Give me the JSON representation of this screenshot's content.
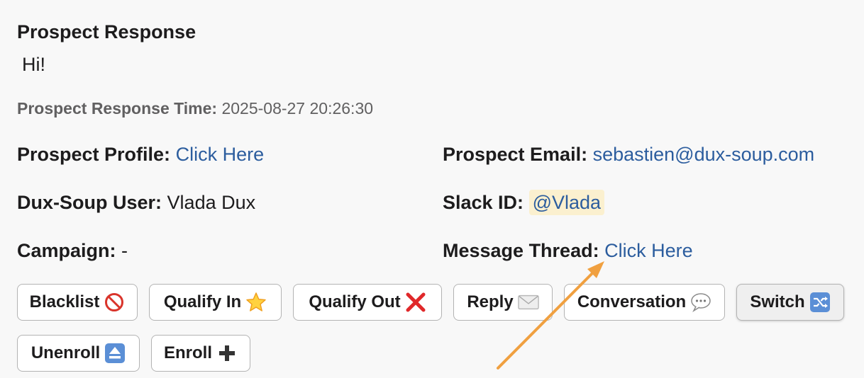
{
  "title": "Prospect Response",
  "response_text": "Hi!",
  "response_time": {
    "label": "Prospect Response Time:",
    "value": "2025-08-27 20:26:30"
  },
  "fields": {
    "profile": {
      "label": "Prospect Profile:",
      "value": "Click Here"
    },
    "email": {
      "label": "Prospect Email:",
      "value": "sebastien@dux-soup.com"
    },
    "user": {
      "label": "Dux-Soup User:",
      "value": "Vlada Dux"
    },
    "slack": {
      "label": "Slack ID:",
      "value": "@Vlada"
    },
    "campaign": {
      "label": "Campaign:",
      "value": "-"
    },
    "thread": {
      "label": "Message Thread:",
      "value": "Click Here"
    }
  },
  "buttons": {
    "blacklist": {
      "label": "Blacklist",
      "icon": "no-entry-icon"
    },
    "qualify_in": {
      "label": "Qualify In",
      "icon": "star-icon"
    },
    "qualify_out": {
      "label": "Qualify Out",
      "icon": "red-x-icon"
    },
    "reply": {
      "label": "Reply",
      "icon": "envelope-icon"
    },
    "conversation": {
      "label": "Conversation",
      "icon": "speech-bubble-icon"
    },
    "switch": {
      "label": "Switch",
      "icon": "shuffle-icon"
    },
    "unenroll": {
      "label": "Unenroll",
      "icon": "eject-icon"
    },
    "enroll": {
      "label": "Enroll",
      "icon": "plus-icon"
    }
  },
  "colors": {
    "link": "#2c5d9e",
    "mention_bg": "#fbf0cf",
    "arrow": "#f0a040"
  }
}
